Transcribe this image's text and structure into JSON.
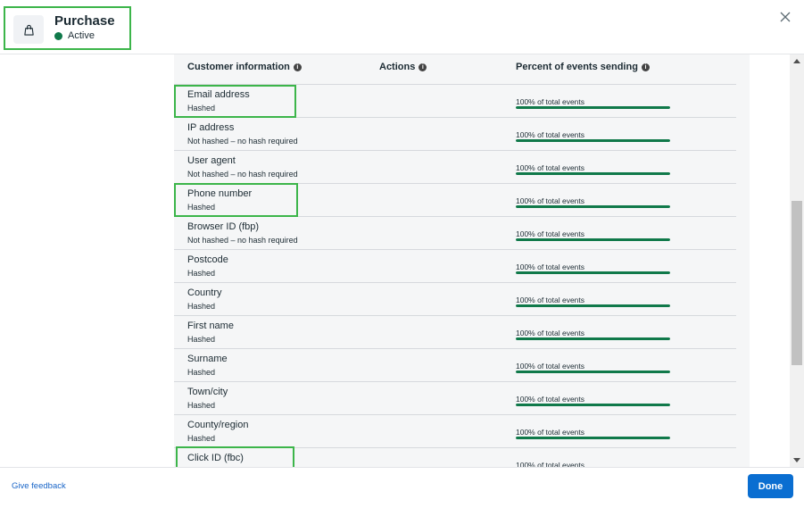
{
  "event": {
    "title": "Purchase",
    "status": "Active",
    "icon": "shopping-bag-icon",
    "status_color": "#10794a"
  },
  "close_icon": "close-icon",
  "table": {
    "headers": {
      "customer_info": "Customer information",
      "actions": "Actions",
      "percent": "Percent of events sending"
    },
    "rows": [
      {
        "name": "Email address",
        "hashing": "Hashed",
        "percent_label": "100% of total events",
        "percent": 100
      },
      {
        "name": "IP address",
        "hashing": "Not hashed – no hash required",
        "percent_label": "100% of total events",
        "percent": 100
      },
      {
        "name": "User agent",
        "hashing": "Not hashed – no hash required",
        "percent_label": "100% of total events",
        "percent": 100
      },
      {
        "name": "Phone number",
        "hashing": "Hashed",
        "percent_label": "100% of total events",
        "percent": 100
      },
      {
        "name": "Browser ID (fbp)",
        "hashing": "Not hashed – no hash required",
        "percent_label": "100% of total events",
        "percent": 100
      },
      {
        "name": "Postcode",
        "hashing": "Hashed",
        "percent_label": "100% of total events",
        "percent": 100
      },
      {
        "name": "Country",
        "hashing": "Hashed",
        "percent_label": "100% of total events",
        "percent": 100
      },
      {
        "name": "First name",
        "hashing": "Hashed",
        "percent_label": "100% of total events",
        "percent": 100
      },
      {
        "name": "Surname",
        "hashing": "Hashed",
        "percent_label": "100% of total events",
        "percent": 100
      },
      {
        "name": "Town/city",
        "hashing": "Hashed",
        "percent_label": "100% of total events",
        "percent": 100
      },
      {
        "name": "County/region",
        "hashing": "Hashed",
        "percent_label": "100% of total events",
        "percent": 100
      },
      {
        "name": "Click ID (fbc)",
        "hashing": "",
        "percent_label": "100% of total events",
        "percent": 100
      }
    ]
  },
  "footer": {
    "feedback": "Give feedback",
    "done": "Done"
  },
  "colors": {
    "accent": "#0a6ed1",
    "bar": "#10794a",
    "highlight": "#3cb54a"
  }
}
